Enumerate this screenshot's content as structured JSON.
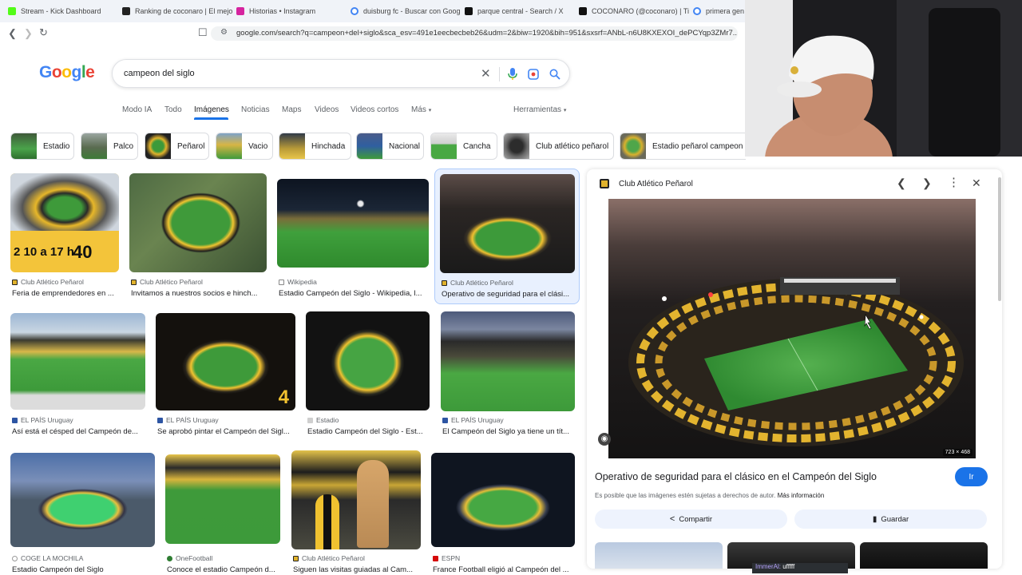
{
  "tabs": [
    {
      "title": "Stream - Kick Dashboard",
      "color": "#53fc18"
    },
    {
      "title": "Ranking de coconaro | El mejo",
      "color": "#222222"
    },
    {
      "title": "Historias • Instagram",
      "color": "#d6249f"
    },
    {
      "title": "duisburg fc - Buscar con Goog",
      "color": "#4285f4"
    },
    {
      "title": "parque central - Search / X",
      "color": "#111111"
    },
    {
      "title": "COCONARO (@coconaro) | Ti",
      "color": "#111111"
    },
    {
      "title": "primera gener",
      "color": "#4285f4"
    }
  ],
  "browser": {
    "url": "google.com/search?q=campeon+del+siglo&sca_esv=491e1eecbecbeb26&udm=2&biw=1920&bih=951&sxsrf=ANbL-n6U8KXEXOI_dePCYqp3ZMr7..."
  },
  "google": {
    "logo": "Google",
    "query": "campeon del siglo",
    "nav": [
      "Modo IA",
      "Todo",
      "Imágenes",
      "Noticias",
      "Maps",
      "Videos",
      "Videos cortos",
      "Más"
    ],
    "tools": "Herramientas"
  },
  "chips": [
    "Estadio",
    "Palco",
    "Peñarol",
    "Vacio",
    "Hinchada",
    "Nacional",
    "Cancha",
    "Club atlético peñarol",
    "Estadio peñarol campeon"
  ],
  "results": [
    {
      "source": "Club Atlético Peñarol",
      "title": "Feria de emprendedores en ..."
    },
    {
      "source": "Club Atlético Peñarol",
      "title": "Invitamos a nuestros socios e hinch..."
    },
    {
      "source": "Wikipedia",
      "title": "Estadio Campeón del Siglo - Wikipedia, l..."
    },
    {
      "source": "Club Atlético Peñarol",
      "title": "Operativo de seguridad para el clási..."
    },
    {
      "source": "EL PAÍS Uruguay",
      "title": "Así está el césped del Campeón de..."
    },
    {
      "source": "EL PAÍS Uruguay",
      "title": "Se aprobó pintar el Campeón del Sigl..."
    },
    {
      "source": "Estadio",
      "title": "Estadio Campeón del Siglo - Est..."
    },
    {
      "source": "EL PAÍS Uruguay",
      "title": "El Campeón del Siglo ya tiene un tít..."
    },
    {
      "source": "COGE LA MOCHILA",
      "title": "Estadio Campeón del Siglo"
    },
    {
      "source": "OneFootball",
      "title": "Conoce el estadio Campeón d..."
    },
    {
      "source": "Club Atlético Peñarol",
      "title": "Siguen las visitas guiadas al Cam..."
    },
    {
      "source": "ESPN",
      "title": "France Football eligió al Campeón del ..."
    }
  ],
  "thumb_texts": {
    "feria_left": "2 10 a 17 h",
    "feria_right": "40",
    "number": "4"
  },
  "panel": {
    "source": "Club Atlético Peñarol",
    "title": "Operativo de seguridad para el clásico en el Campeón del Siglo",
    "go_label": "Ir",
    "disclaimer": "Es posible que las imágenes estén sujetas a derechos de autor.",
    "more_info": "Más información",
    "share_label": "Compartir",
    "save_label": "Guardar",
    "dims": "723 × 468"
  },
  "overlay": {
    "chat_user": "ImmerAl:",
    "chat_text": "ufffff"
  },
  "colors": {
    "accent": "#1a73e8",
    "penarol_yellow": "#f2c230",
    "pitch_green": "#3e9a3a"
  }
}
